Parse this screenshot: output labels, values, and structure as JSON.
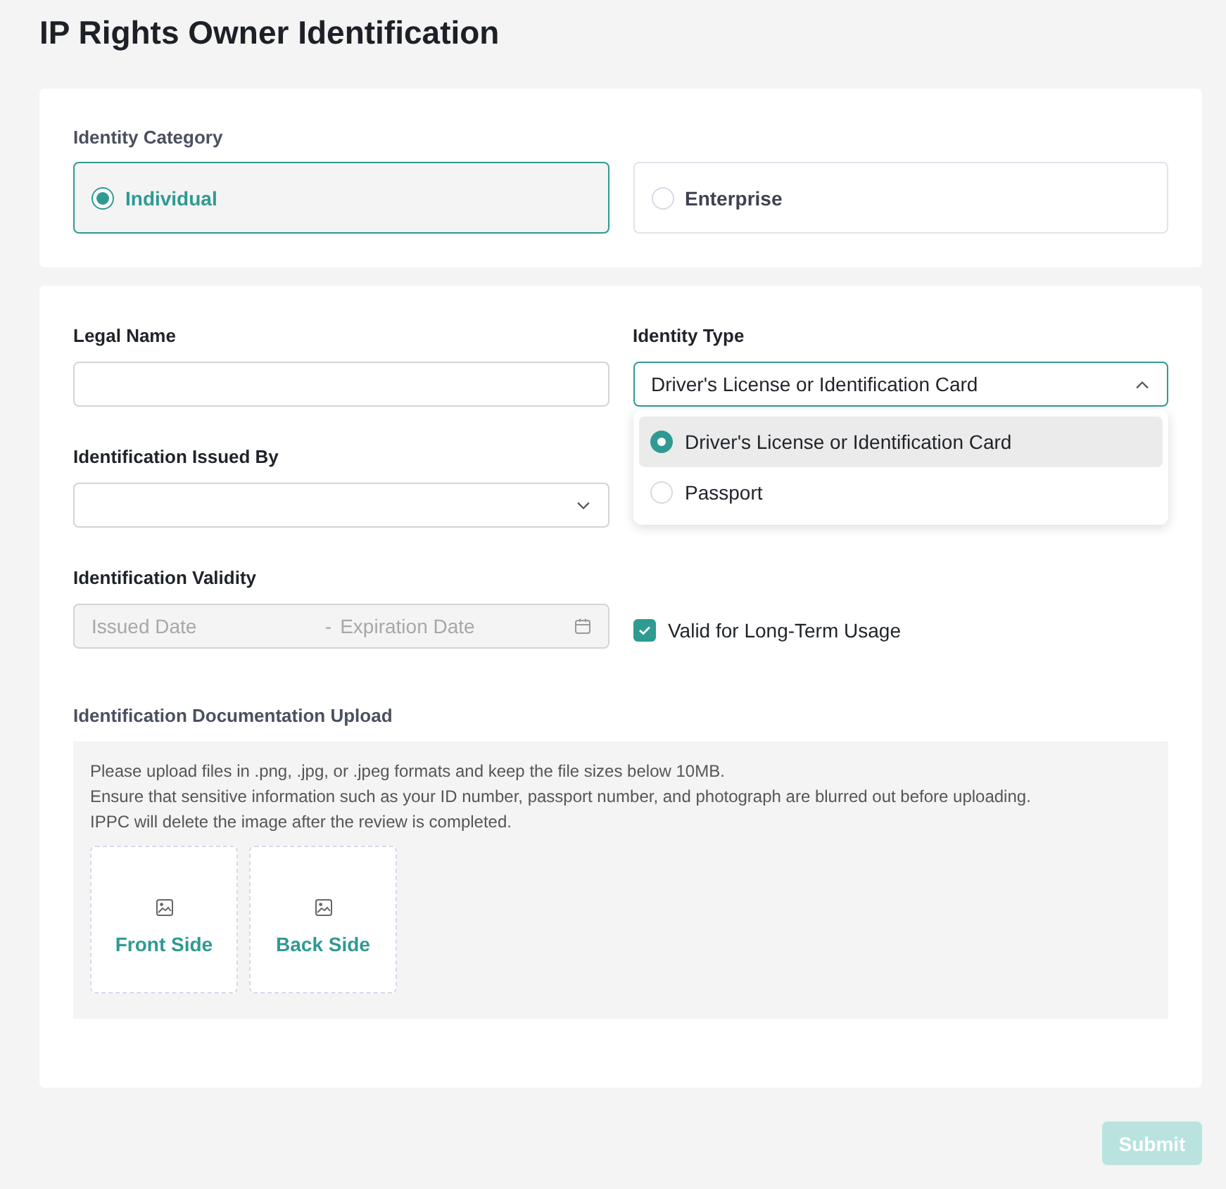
{
  "page": {
    "title": "IP Rights Owner Identification"
  },
  "identity_category": {
    "label": "Identity Category",
    "options": [
      {
        "label": "Individual",
        "selected": true
      },
      {
        "label": "Enterprise",
        "selected": false
      }
    ]
  },
  "legal_name": {
    "label": "Legal Name"
  },
  "identity_type": {
    "label": "Identity Type",
    "value": "Driver's License or Identification Card",
    "expanded": true,
    "options": [
      {
        "label": "Driver's License or Identification Card",
        "selected": true
      },
      {
        "label": "Passport",
        "selected": false
      }
    ]
  },
  "issued_by": {
    "label": "Identification Issued By"
  },
  "validity": {
    "label": "Identification Validity",
    "start_placeholder": "Issued Date",
    "separator": "-",
    "end_placeholder": "Expiration Date",
    "disabled": true,
    "long_term": {
      "label": "Valid for Long-Term Usage",
      "checked": true
    }
  },
  "upload": {
    "label": "Identification Documentation Upload",
    "notes": [
      "Please upload files in .png, .jpg, or .jpeg formats and keep the file sizes below 10MB.",
      "Ensure that sensitive information such as your ID number, passport number, and photograph are blurred out before uploading.",
      "IPPC will delete the image after the review is completed."
    ],
    "slots": [
      {
        "label": "Front Side"
      },
      {
        "label": "Back Side"
      }
    ]
  },
  "submit": {
    "label": "Submit",
    "disabled": true
  }
}
